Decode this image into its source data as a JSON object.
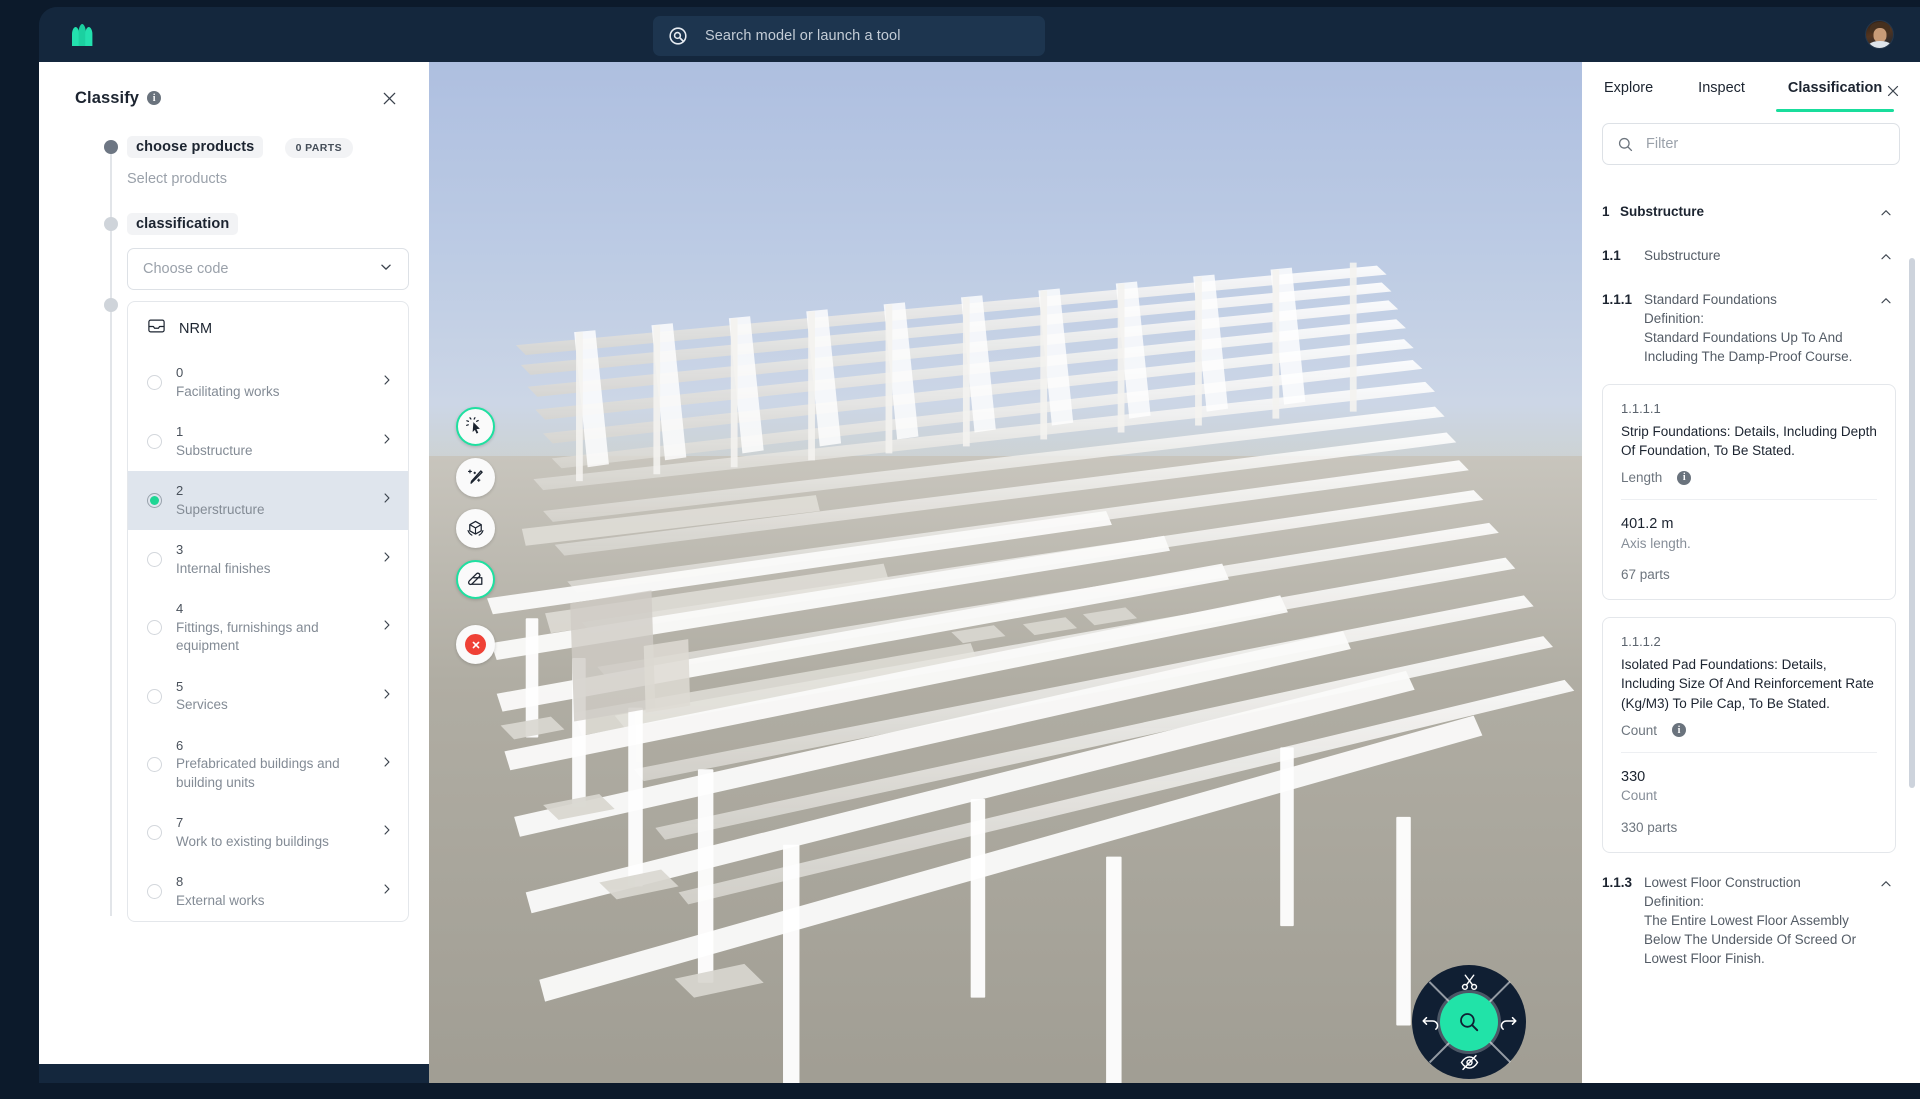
{
  "topbar": {
    "logo_name": "mountain-logo",
    "search_placeholder": "Search model or launch a tool",
    "search_value": "",
    "avatar_name": "user-avatar"
  },
  "classify_panel": {
    "title": "Classify",
    "info_glyph": "i",
    "close_glyph": "✕",
    "steps": [
      {
        "chip": "choose products",
        "badge": "0 PARTS",
        "sub": "Select products"
      },
      {
        "chip": "classification",
        "badge": "",
        "sub": ""
      }
    ],
    "choose_code": {
      "placeholder": "Choose code",
      "value": ""
    },
    "codelist": {
      "header": "NRM",
      "header_icon": "folder-icon",
      "items": [
        {
          "num": "0",
          "label": "Facilitating works",
          "selected": false
        },
        {
          "num": "1",
          "label": "Substructure",
          "selected": false
        },
        {
          "num": "2",
          "label": "Superstructure",
          "selected": true
        },
        {
          "num": "3",
          "label": "Internal finishes",
          "selected": false
        },
        {
          "num": "4",
          "label": "Fittings, furnishings and equipment",
          "selected": false
        },
        {
          "num": "5",
          "label": "Services",
          "selected": false
        },
        {
          "num": "6",
          "label": "Prefabricated buildings and building units",
          "selected": false
        },
        {
          "num": "7",
          "label": "Work to existing buildings",
          "selected": false
        },
        {
          "num": "8",
          "label": "External works",
          "selected": false
        }
      ]
    }
  },
  "viewport": {
    "tools": [
      {
        "name": "select-cursor-tool",
        "active": true
      },
      {
        "name": "magic-wand-tool",
        "active": false
      },
      {
        "name": "rotate-model-tool",
        "active": false
      },
      {
        "name": "tag-label-tool",
        "active": true
      },
      {
        "name": "cancel-tool",
        "active": false
      }
    ],
    "radial": {
      "top": "scissors-icon",
      "left": "undo-icon",
      "right": "redo-icon",
      "bottom": "hide-eye-icon",
      "center": "zoom-search-icon"
    }
  },
  "right_panel": {
    "tabs": [
      {
        "label": "Explore",
        "active": false
      },
      {
        "label": "Inspect",
        "active": false
      },
      {
        "label": "Classification",
        "active": true
      }
    ],
    "close_glyph": "✕",
    "filter": {
      "placeholder": "Filter",
      "value": "",
      "icon": "search-icon"
    },
    "tree": [
      {
        "level": 1,
        "code": "1",
        "name": "Substructure",
        "expanded": true
      },
      {
        "level": 2,
        "code": "1.1",
        "name": "Substructure",
        "expanded": true
      },
      {
        "level": 3,
        "code": "1.1.1",
        "name": "Standard Foundations\nDefinition:\nStandard Foundations Up To And Including The Damp-Proof Course.",
        "expanded": true
      }
    ],
    "cards": [
      {
        "code": "1.1.1.1",
        "title": "Strip Foundations: Details, Including Depth Of Foundation, To Be Stated.",
        "metric_label": "Length",
        "metric_info": "i",
        "value": "401.2 m",
        "value_sub": "Axis length.",
        "parts": "67 parts"
      },
      {
        "code": "1.1.1.2",
        "title": "Isolated Pad Foundations: Details, Including Size Of And Reinforcement Rate (Kg/M3) To Pile Cap, To Be Stated.",
        "metric_label": "Count",
        "metric_info": "i",
        "value": "330",
        "value_sub": "Count",
        "parts": "330 parts"
      }
    ],
    "tree_tail": [
      {
        "level": 3,
        "code": "1.1.3",
        "name": "Lowest Floor Construction\nDefinition:\nThe Entire Lowest Floor Assembly Below The Underside Of Screed Or Lowest Floor Finish.",
        "expanded": true
      }
    ]
  },
  "colors": {
    "accent_green": "#19dd9c",
    "dark_navy": "#14273d",
    "shell_navy": "#0c1a2b",
    "danger_red": "#ef4136",
    "selection_blue": "#dfe5ed"
  }
}
